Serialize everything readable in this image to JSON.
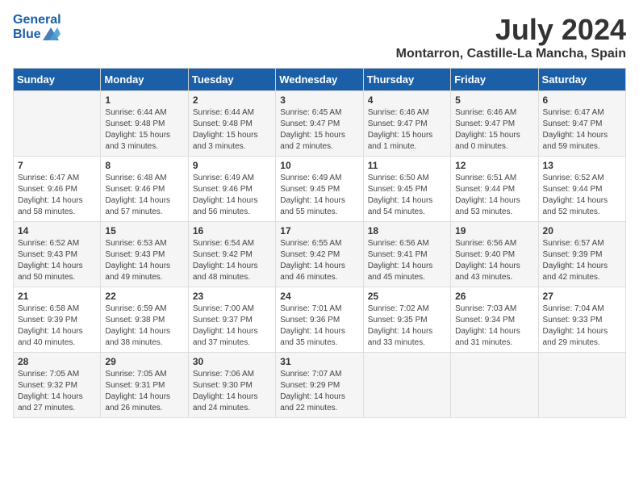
{
  "header": {
    "logo_line1": "General",
    "logo_line2": "Blue",
    "month": "July 2024",
    "location": "Montarron, Castille-La Mancha, Spain"
  },
  "days_of_week": [
    "Sunday",
    "Monday",
    "Tuesday",
    "Wednesday",
    "Thursday",
    "Friday",
    "Saturday"
  ],
  "weeks": [
    [
      {
        "day": "",
        "sunrise": "",
        "sunset": "",
        "daylight": ""
      },
      {
        "day": "1",
        "sunrise": "Sunrise: 6:44 AM",
        "sunset": "Sunset: 9:48 PM",
        "daylight": "Daylight: 15 hours and 3 minutes."
      },
      {
        "day": "2",
        "sunrise": "Sunrise: 6:44 AM",
        "sunset": "Sunset: 9:48 PM",
        "daylight": "Daylight: 15 hours and 3 minutes."
      },
      {
        "day": "3",
        "sunrise": "Sunrise: 6:45 AM",
        "sunset": "Sunset: 9:47 PM",
        "daylight": "Daylight: 15 hours and 2 minutes."
      },
      {
        "day": "4",
        "sunrise": "Sunrise: 6:46 AM",
        "sunset": "Sunset: 9:47 PM",
        "daylight": "Daylight: 15 hours and 1 minute."
      },
      {
        "day": "5",
        "sunrise": "Sunrise: 6:46 AM",
        "sunset": "Sunset: 9:47 PM",
        "daylight": "Daylight: 15 hours and 0 minutes."
      },
      {
        "day": "6",
        "sunrise": "Sunrise: 6:47 AM",
        "sunset": "Sunset: 9:47 PM",
        "daylight": "Daylight: 14 hours and 59 minutes."
      }
    ],
    [
      {
        "day": "7",
        "sunrise": "Sunrise: 6:47 AM",
        "sunset": "Sunset: 9:46 PM",
        "daylight": "Daylight: 14 hours and 58 minutes."
      },
      {
        "day": "8",
        "sunrise": "Sunrise: 6:48 AM",
        "sunset": "Sunset: 9:46 PM",
        "daylight": "Daylight: 14 hours and 57 minutes."
      },
      {
        "day": "9",
        "sunrise": "Sunrise: 6:49 AM",
        "sunset": "Sunset: 9:46 PM",
        "daylight": "Daylight: 14 hours and 56 minutes."
      },
      {
        "day": "10",
        "sunrise": "Sunrise: 6:49 AM",
        "sunset": "Sunset: 9:45 PM",
        "daylight": "Daylight: 14 hours and 55 minutes."
      },
      {
        "day": "11",
        "sunrise": "Sunrise: 6:50 AM",
        "sunset": "Sunset: 9:45 PM",
        "daylight": "Daylight: 14 hours and 54 minutes."
      },
      {
        "day": "12",
        "sunrise": "Sunrise: 6:51 AM",
        "sunset": "Sunset: 9:44 PM",
        "daylight": "Daylight: 14 hours and 53 minutes."
      },
      {
        "day": "13",
        "sunrise": "Sunrise: 6:52 AM",
        "sunset": "Sunset: 9:44 PM",
        "daylight": "Daylight: 14 hours and 52 minutes."
      }
    ],
    [
      {
        "day": "14",
        "sunrise": "Sunrise: 6:52 AM",
        "sunset": "Sunset: 9:43 PM",
        "daylight": "Daylight: 14 hours and 50 minutes."
      },
      {
        "day": "15",
        "sunrise": "Sunrise: 6:53 AM",
        "sunset": "Sunset: 9:43 PM",
        "daylight": "Daylight: 14 hours and 49 minutes."
      },
      {
        "day": "16",
        "sunrise": "Sunrise: 6:54 AM",
        "sunset": "Sunset: 9:42 PM",
        "daylight": "Daylight: 14 hours and 48 minutes."
      },
      {
        "day": "17",
        "sunrise": "Sunrise: 6:55 AM",
        "sunset": "Sunset: 9:42 PM",
        "daylight": "Daylight: 14 hours and 46 minutes."
      },
      {
        "day": "18",
        "sunrise": "Sunrise: 6:56 AM",
        "sunset": "Sunset: 9:41 PM",
        "daylight": "Daylight: 14 hours and 45 minutes."
      },
      {
        "day": "19",
        "sunrise": "Sunrise: 6:56 AM",
        "sunset": "Sunset: 9:40 PM",
        "daylight": "Daylight: 14 hours and 43 minutes."
      },
      {
        "day": "20",
        "sunrise": "Sunrise: 6:57 AM",
        "sunset": "Sunset: 9:39 PM",
        "daylight": "Daylight: 14 hours and 42 minutes."
      }
    ],
    [
      {
        "day": "21",
        "sunrise": "Sunrise: 6:58 AM",
        "sunset": "Sunset: 9:39 PM",
        "daylight": "Daylight: 14 hours and 40 minutes."
      },
      {
        "day": "22",
        "sunrise": "Sunrise: 6:59 AM",
        "sunset": "Sunset: 9:38 PM",
        "daylight": "Daylight: 14 hours and 38 minutes."
      },
      {
        "day": "23",
        "sunrise": "Sunrise: 7:00 AM",
        "sunset": "Sunset: 9:37 PM",
        "daylight": "Daylight: 14 hours and 37 minutes."
      },
      {
        "day": "24",
        "sunrise": "Sunrise: 7:01 AM",
        "sunset": "Sunset: 9:36 PM",
        "daylight": "Daylight: 14 hours and 35 minutes."
      },
      {
        "day": "25",
        "sunrise": "Sunrise: 7:02 AM",
        "sunset": "Sunset: 9:35 PM",
        "daylight": "Daylight: 14 hours and 33 minutes."
      },
      {
        "day": "26",
        "sunrise": "Sunrise: 7:03 AM",
        "sunset": "Sunset: 9:34 PM",
        "daylight": "Daylight: 14 hours and 31 minutes."
      },
      {
        "day": "27",
        "sunrise": "Sunrise: 7:04 AM",
        "sunset": "Sunset: 9:33 PM",
        "daylight": "Daylight: 14 hours and 29 minutes."
      }
    ],
    [
      {
        "day": "28",
        "sunrise": "Sunrise: 7:05 AM",
        "sunset": "Sunset: 9:32 PM",
        "daylight": "Daylight: 14 hours and 27 minutes."
      },
      {
        "day": "29",
        "sunrise": "Sunrise: 7:05 AM",
        "sunset": "Sunset: 9:31 PM",
        "daylight": "Daylight: 14 hours and 26 minutes."
      },
      {
        "day": "30",
        "sunrise": "Sunrise: 7:06 AM",
        "sunset": "Sunset: 9:30 PM",
        "daylight": "Daylight: 14 hours and 24 minutes."
      },
      {
        "day": "31",
        "sunrise": "Sunrise: 7:07 AM",
        "sunset": "Sunset: 9:29 PM",
        "daylight": "Daylight: 14 hours and 22 minutes."
      },
      {
        "day": "",
        "sunrise": "",
        "sunset": "",
        "daylight": ""
      },
      {
        "day": "",
        "sunrise": "",
        "sunset": "",
        "daylight": ""
      },
      {
        "day": "",
        "sunrise": "",
        "sunset": "",
        "daylight": ""
      }
    ]
  ]
}
